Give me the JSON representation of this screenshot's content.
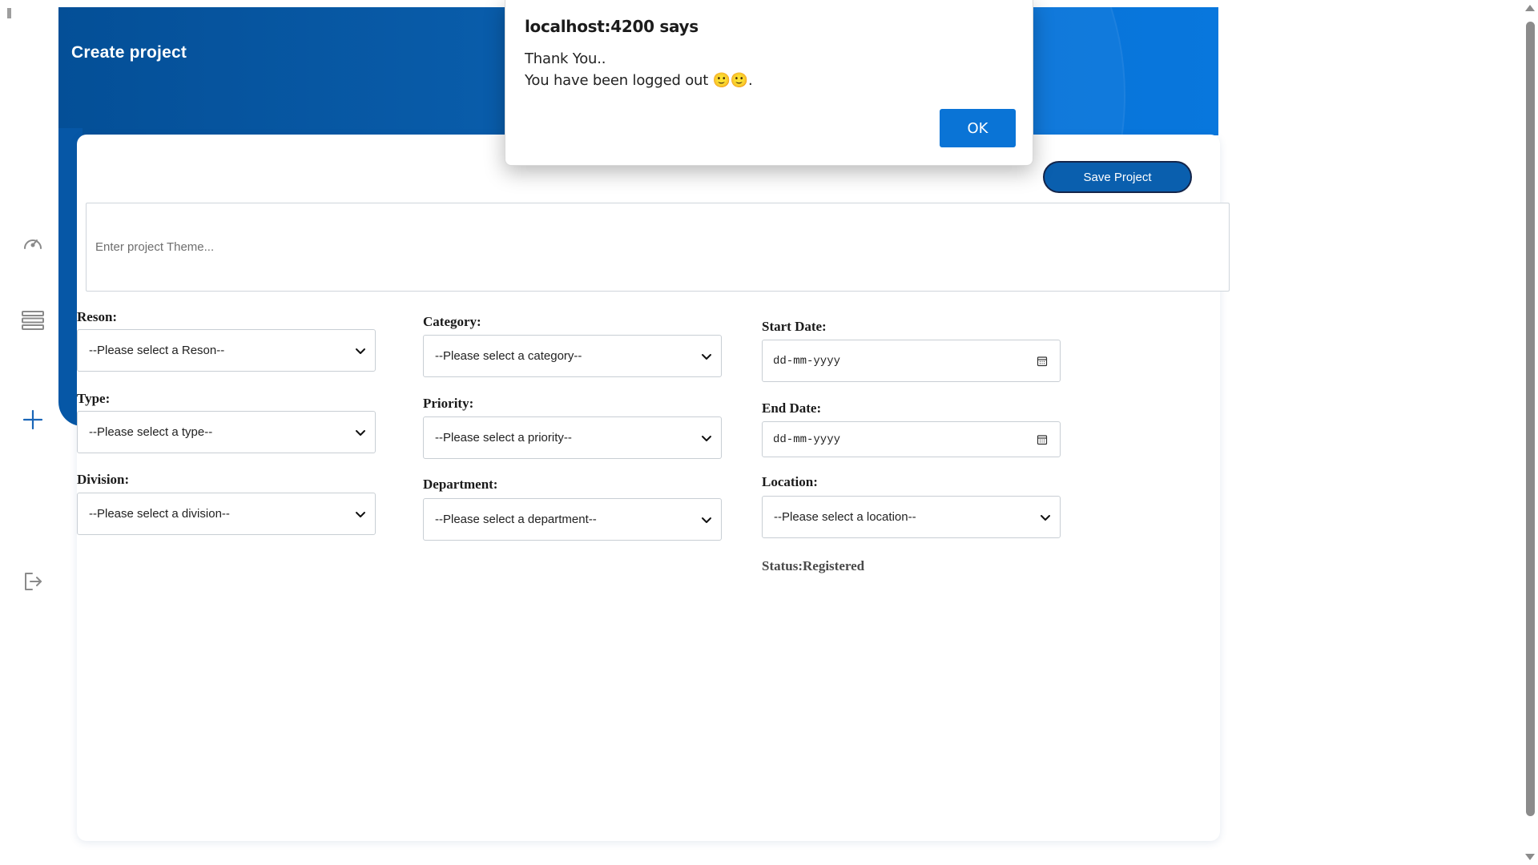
{
  "header": {
    "title": "Create project"
  },
  "sidebar": {
    "items": [
      {
        "icon": "speedometer-icon"
      },
      {
        "icon": "list-icon"
      },
      {
        "icon": "plus-icon"
      },
      {
        "icon": "logout-icon"
      }
    ]
  },
  "toolbar": {
    "save_label": "Save Project"
  },
  "form": {
    "theme_placeholder": "Enter project Theme...",
    "reason": {
      "label": "Reson:",
      "value": "--Please select a Reson--"
    },
    "type": {
      "label": "Type:",
      "value": "--Please select a type--"
    },
    "division": {
      "label": "Division:",
      "value": "--Please select a division--"
    },
    "category": {
      "label": "Category:",
      "value": "--Please select a category--"
    },
    "priority": {
      "label": "Priority:",
      "value": "--Please select a priority--"
    },
    "department": {
      "label": "Department:",
      "value": "--Please select a department--"
    },
    "start_date": {
      "label": "Start Date:",
      "value": "dd-mm-yyyy"
    },
    "end_date": {
      "label": "End Date:",
      "value": "dd-mm-yyyy"
    },
    "location": {
      "label": "Location:",
      "value": "--Please select a location--"
    },
    "status": "Status:Registered"
  },
  "dialog": {
    "title": "localhost:4200 says",
    "line1": "Thank You..",
    "line2": "You have been logged out 🙂🙂.",
    "ok_label": "OK"
  },
  "colors": {
    "brand": "#0a5fae",
    "header_dark": "#044f97",
    "header_light": "#0877dd",
    "ok_button": "#0a74d6"
  }
}
